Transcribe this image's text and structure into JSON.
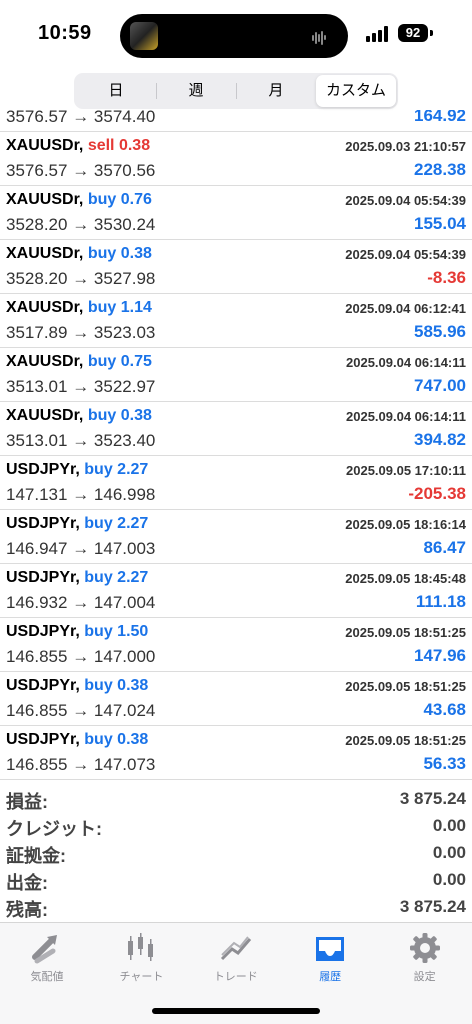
{
  "status": {
    "time": "10:59",
    "battery": "92"
  },
  "period_tabs": [
    {
      "label": "日"
    },
    {
      "label": "週"
    },
    {
      "label": "月"
    },
    {
      "label": "カスタム"
    }
  ],
  "trades": [
    {
      "symbol": "",
      "side": "",
      "side_type": "buy",
      "lots": "",
      "date": "",
      "open": "3576.57",
      "close": "3574.40",
      "profit": "164.92",
      "profit_type": "pos"
    },
    {
      "symbol": "XAUUSDr,",
      "side": "sell",
      "side_type": "sell",
      "lots": "0.38",
      "date": "2025.09.03 21:10:57",
      "open": "3576.57",
      "close": "3570.56",
      "profit": "228.38",
      "profit_type": "pos"
    },
    {
      "symbol": "XAUUSDr,",
      "side": "buy",
      "side_type": "buy",
      "lots": "0.76",
      "date": "2025.09.04 05:54:39",
      "open": "3528.20",
      "close": "3530.24",
      "profit": "155.04",
      "profit_type": "pos"
    },
    {
      "symbol": "XAUUSDr,",
      "side": "buy",
      "side_type": "buy",
      "lots": "0.38",
      "date": "2025.09.04 05:54:39",
      "open": "3528.20",
      "close": "3527.98",
      "profit": "-8.36",
      "profit_type": "neg"
    },
    {
      "symbol": "XAUUSDr,",
      "side": "buy",
      "side_type": "buy",
      "lots": "1.14",
      "date": "2025.09.04 06:12:41",
      "open": "3517.89",
      "close": "3523.03",
      "profit": "585.96",
      "profit_type": "pos"
    },
    {
      "symbol": "XAUUSDr,",
      "side": "buy",
      "side_type": "buy",
      "lots": "0.75",
      "date": "2025.09.04 06:14:11",
      "open": "3513.01",
      "close": "3522.97",
      "profit": "747.00",
      "profit_type": "pos"
    },
    {
      "symbol": "XAUUSDr,",
      "side": "buy",
      "side_type": "buy",
      "lots": "0.38",
      "date": "2025.09.04 06:14:11",
      "open": "3513.01",
      "close": "3523.40",
      "profit": "394.82",
      "profit_type": "pos"
    },
    {
      "symbol": "USDJPYr,",
      "side": "buy",
      "side_type": "buy",
      "lots": "2.27",
      "date": "2025.09.05 17:10:11",
      "open": "147.131",
      "close": "146.998",
      "profit": "-205.38",
      "profit_type": "neg"
    },
    {
      "symbol": "USDJPYr,",
      "side": "buy",
      "side_type": "buy",
      "lots": "2.27",
      "date": "2025.09.05 18:16:14",
      "open": "146.947",
      "close": "147.003",
      "profit": "86.47",
      "profit_type": "pos"
    },
    {
      "symbol": "USDJPYr,",
      "side": "buy",
      "side_type": "buy",
      "lots": "2.27",
      "date": "2025.09.05 18:45:48",
      "open": "146.932",
      "close": "147.004",
      "profit": "111.18",
      "profit_type": "pos"
    },
    {
      "symbol": "USDJPYr,",
      "side": "buy",
      "side_type": "buy",
      "lots": "1.50",
      "date": "2025.09.05 18:51:25",
      "open": "146.855",
      "close": "147.000",
      "profit": "147.96",
      "profit_type": "pos"
    },
    {
      "symbol": "USDJPYr,",
      "side": "buy",
      "side_type": "buy",
      "lots": "0.38",
      "date": "2025.09.05 18:51:25",
      "open": "146.855",
      "close": "147.024",
      "profit": "43.68",
      "profit_type": "pos"
    },
    {
      "symbol": "USDJPYr,",
      "side": "buy",
      "side_type": "buy",
      "lots": "0.38",
      "date": "2025.09.05 18:51:25",
      "open": "146.855",
      "close": "147.073",
      "profit": "56.33",
      "profit_type": "pos"
    }
  ],
  "arrow": "→",
  "summary": [
    {
      "label": "損益:",
      "value": "3 875.24"
    },
    {
      "label": "クレジット:",
      "value": "0.00"
    },
    {
      "label": "証拠金:",
      "value": "0.00"
    },
    {
      "label": "出金:",
      "value": "0.00"
    },
    {
      "label": "残高:",
      "value": "3 875.24"
    }
  ],
  "tabbar": [
    {
      "label": "気配値",
      "icon": "quotes-arrows-icon"
    },
    {
      "label": "チャート",
      "icon": "candlestick-chart-icon"
    },
    {
      "label": "トレード",
      "icon": "trade-line-icon"
    },
    {
      "label": "履歴",
      "icon": "history-inbox-icon"
    },
    {
      "label": "設定",
      "icon": "gear-icon"
    }
  ],
  "colors": {
    "buy": "#1a73e8",
    "sell": "#e53935",
    "active_tab": "#1a73e8",
    "inactive_tab": "#8e8e93"
  },
  "active_period": 3,
  "active_tab": 3
}
